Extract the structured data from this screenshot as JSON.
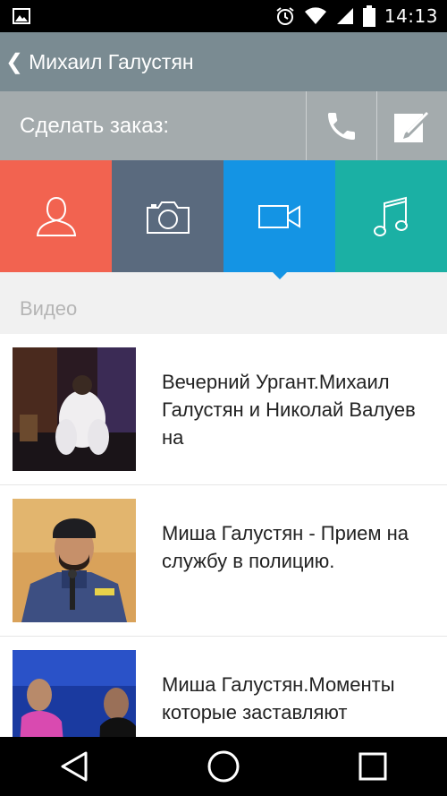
{
  "status_bar": {
    "time": "14:13",
    "icons": [
      "image-icon",
      "alarm-icon",
      "wifi-icon",
      "signal-icon",
      "battery-icon"
    ]
  },
  "header": {
    "back_icon": "chevron-left",
    "title": "Михаил Галустян"
  },
  "order": {
    "label": "Сделать заказ:",
    "icons": [
      "phone-icon",
      "edit-icon"
    ]
  },
  "tabs": [
    {
      "icon": "person-icon",
      "color": "#f26350"
    },
    {
      "icon": "camera-icon",
      "color": "#5a6a7e"
    },
    {
      "icon": "video-icon",
      "color": "#1494e4",
      "active": true
    },
    {
      "icon": "music-icon",
      "color": "#1bb0a4"
    }
  ],
  "section": {
    "label": "Видео"
  },
  "videos": [
    {
      "title": "Вечерний Ургант.Михаил Галустян и Николай Валуев на"
    },
    {
      "title": "Миша Галустян - Прием на службу в полицию."
    },
    {
      "title": "Миша Галустян.Моменты которые заставляют"
    }
  ],
  "nav": {
    "icons": [
      "back-icon",
      "home-icon",
      "recents-icon"
    ]
  }
}
